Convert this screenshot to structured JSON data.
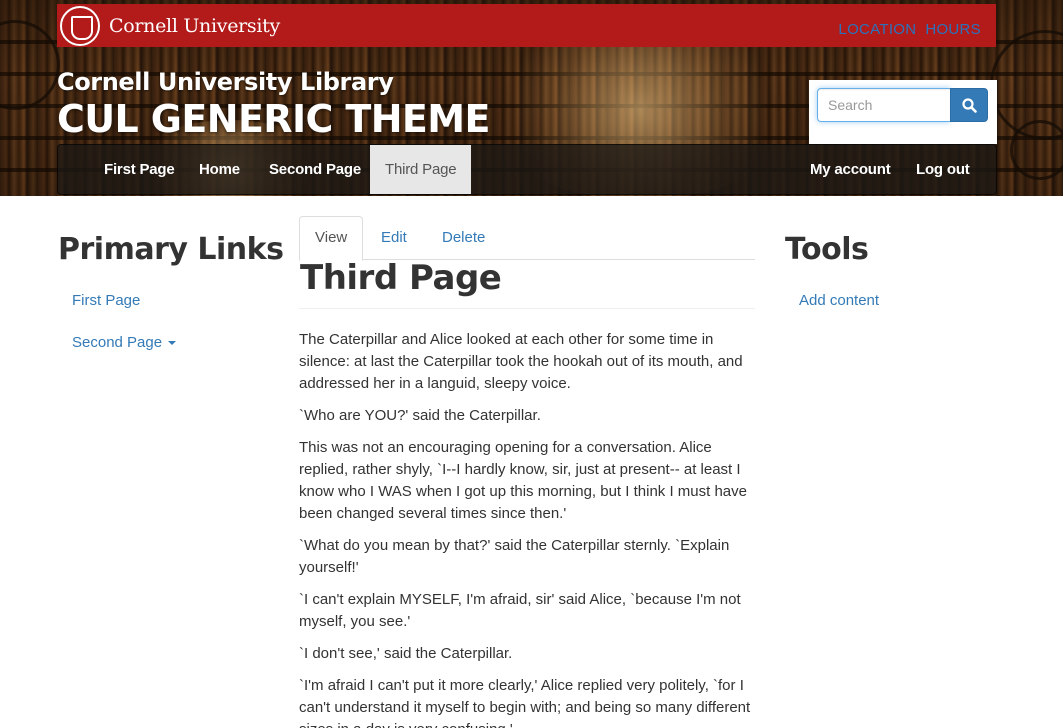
{
  "header": {
    "university_name": "Cornell University",
    "location_hours_label": "LOCATION  HOURS",
    "library_title": "Cornell University Library",
    "theme_title": "CUL GENERIC THEME"
  },
  "search": {
    "placeholder": "Search"
  },
  "nav": {
    "items": [
      {
        "label": "First Page"
      },
      {
        "label": "Home"
      },
      {
        "label": "Second Page"
      },
      {
        "label": "Third Page"
      }
    ],
    "account_label": "My account",
    "logout_label": "Log out"
  },
  "sidebar_left": {
    "heading": "Primary Links",
    "links": [
      {
        "label": "First Page"
      },
      {
        "label": "Second Page"
      }
    ]
  },
  "tabs": [
    {
      "label": "View"
    },
    {
      "label": "Edit"
    },
    {
      "label": "Delete"
    }
  ],
  "page": {
    "title": "Third Page",
    "paragraphs": [
      "The Caterpillar and Alice looked at each other for some time in silence: at last the Caterpillar took the hookah out of its mouth, and addressed her in a languid, sleepy voice.",
      "`Who are YOU?' said the Caterpillar.",
      "This was not an encouraging opening for a conversation. Alice replied, rather shyly, `I--I hardly know, sir, just at present-- at least I know who I WAS when I got up this morning, but I think I must have been changed several times since then.'",
      "`What do you mean by that?' said the Caterpillar sternly. `Explain yourself!'",
      "`I can't explain MYSELF, I'm afraid, sir' said Alice, `because I'm not myself, you see.'",
      "`I don't see,' said the Caterpillar.",
      "`I'm afraid I can't put it more clearly,' Alice replied very politely, `for I can't understand it myself to begin with; and being so many different sizes in a day is very confusing.'"
    ]
  },
  "sidebar_right": {
    "heading": "Tools",
    "links": [
      {
        "label": "Add content"
      }
    ]
  },
  "colors": {
    "cornell_red": "#b31b1b",
    "link_blue": "#337ab7"
  },
  "icons": {
    "seal": "cornell-seal-icon",
    "search": "magnifier-icon",
    "caret": "caret-down-icon"
  }
}
